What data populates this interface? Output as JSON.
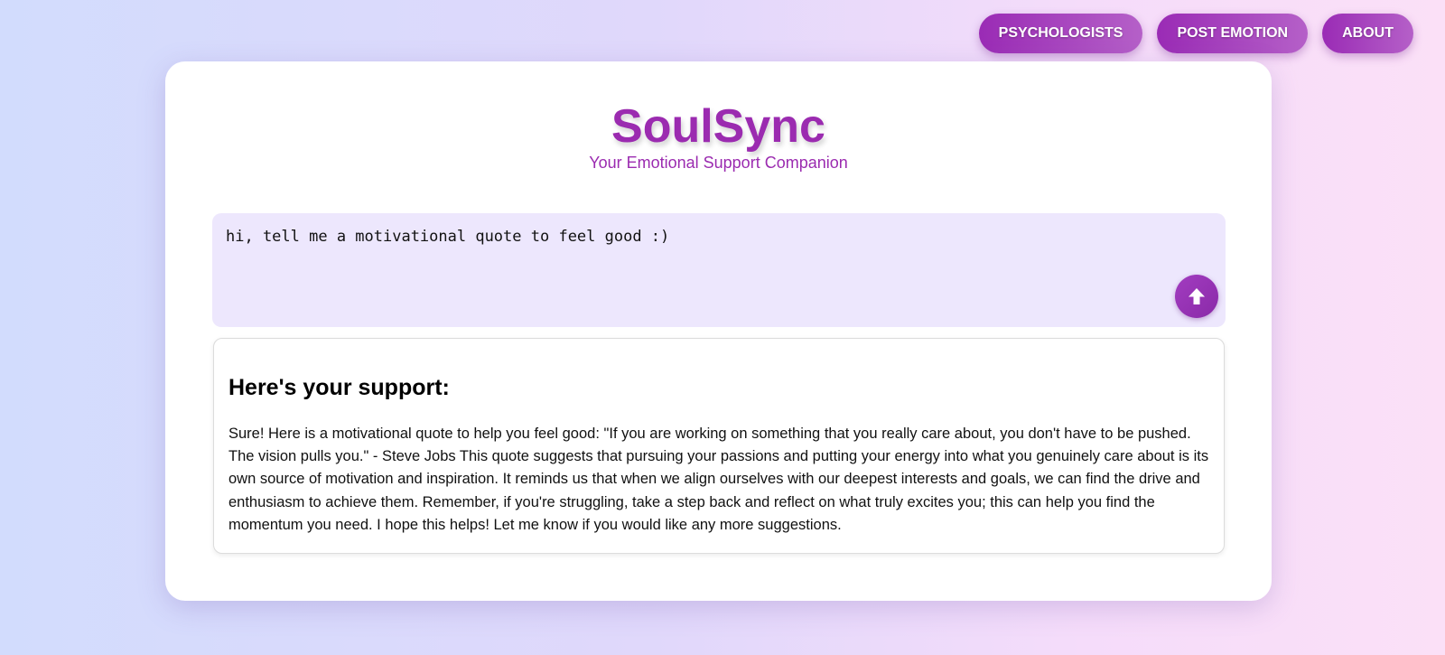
{
  "nav": {
    "items": [
      {
        "label": "PSYCHOLOGISTS"
      },
      {
        "label": "POST EMOTION"
      },
      {
        "label": "ABOUT"
      }
    ]
  },
  "header": {
    "title": "SoulSync",
    "subtitle": "Your Emotional Support Companion"
  },
  "input": {
    "value": "hi, tell me a motivational quote to feel good :)",
    "send_icon": "arrow-up-icon"
  },
  "response": {
    "heading": "Here's your support:",
    "body": "Sure! Here is a motivational quote to help you feel good: \"If you are working on something that you really care about, you don't have to be pushed. The vision pulls you.\" - Steve Jobs This quote suggests that pursuing your passions and putting your energy into what you genuinely care about is its own source of motivation and inspiration. It reminds us that when we align ourselves with our deepest interests and goals, we can find the drive and enthusiasm to achieve them. Remember, if you're struggling, take a step back and reflect on what truly excites you; this can help you find the momentum you need. I hope this helps! Let me know if you would like any more suggestions."
  },
  "colors": {
    "accent": "#9b2bb0",
    "input_bg": "#ede7fd",
    "card_bg": "#ffffff"
  }
}
